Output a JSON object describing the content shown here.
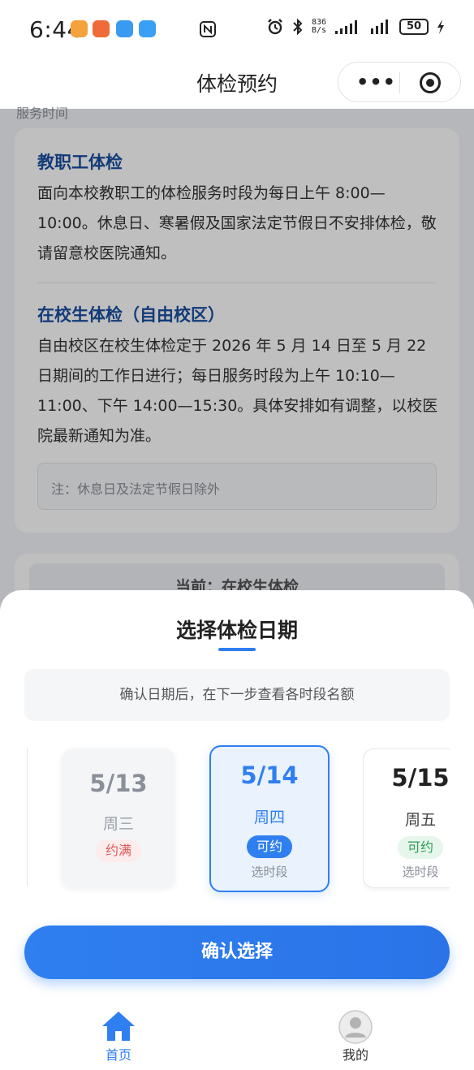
{
  "status_bar": {
    "time": "6:44",
    "net_speed_value": "836",
    "net_speed_unit": "B/s",
    "battery": "50"
  },
  "navbar": {
    "title": "体检预约"
  },
  "background": {
    "section_label": "服务时间",
    "staff": {
      "title": "教职工体检",
      "text": "面向本校教职工的体检服务时段为每日上午 8:00—10:00。休息日、寒暑假及国家法定节假日不安排体检，敬请留意校医院通知。"
    },
    "student": {
      "title": "在校生体检（自由校区）",
      "text": "自由校区在校生体检定于 2026 年 5 月 14 日至 5 月 22 日期间的工作日进行；每日服务时段为上午 10:10—11:00、下午 14:00—15:30。具体安排如有调整，以校医院最新通知为准。"
    },
    "note": "注：休息日及法定节假日除外",
    "current": "当前：在校生体检"
  },
  "sheet": {
    "title": "选择体检日期",
    "hint": "确认日期后，在下一步查看各时段名额",
    "days": [
      {
        "date": "5/13",
        "week": "周三",
        "status": "约满",
        "sub": ""
      },
      {
        "date": "5/14",
        "week": "周四",
        "status": "可约",
        "sub": "选时段"
      },
      {
        "date": "5/15",
        "week": "周五",
        "status": "可约",
        "sub": "选时段"
      }
    ],
    "confirm": "确认选择"
  },
  "tabbar": {
    "home": "首页",
    "mine": "我的"
  },
  "colors": {
    "accent": "#2f7ff0",
    "full_badge": "#e05a5a",
    "available_green": "#2e9d55"
  }
}
